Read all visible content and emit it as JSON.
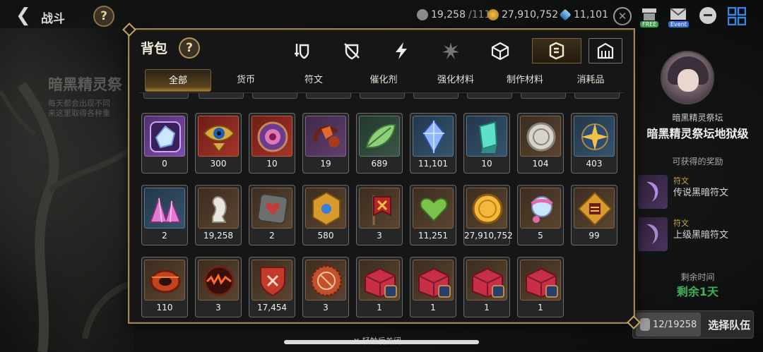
{
  "header": {
    "back_label": "战斗",
    "help_label": "?",
    "currencies": [
      {
        "name": "tokens",
        "value": "19,258",
        "suffix": "/111",
        "icon": "token-icon"
      },
      {
        "name": "gold",
        "value": "27,910,752",
        "icon": "gold-coin-icon"
      },
      {
        "name": "crystal",
        "value": "11,101",
        "icon": "crystal-icon"
      }
    ],
    "free_tag": "FREE",
    "event_tag": "Event"
  },
  "background": {
    "left_title": "暗黑精灵祭",
    "left_text_1": "每天都会出现不同",
    "left_text_2": "来这里取得各种重"
  },
  "right_panel": {
    "subtitle": "暗黑精灵祭坛",
    "title": "暗黑精灵祭坛地狱级",
    "rewards_label": "可获得的奖励",
    "rewards": [
      {
        "tag": "符文",
        "name": "传说黑暗符文"
      },
      {
        "tag": "符文",
        "name": "上级黑暗符文"
      }
    ],
    "remaining_label": "剩余时间",
    "remaining_value": "剩余1天",
    "team_count": "12/19258",
    "team_button": "选择队伍"
  },
  "bag": {
    "title": "背包",
    "help_label": "?",
    "category_icons": [
      "weapon-icon",
      "armor-icon",
      "lightning-icon",
      "spark-icon",
      "dice-icon",
      "material-icon",
      "shop-icon"
    ],
    "active_category": 5,
    "sub_tabs": [
      "全部",
      "货币",
      "符文",
      "催化剂",
      "强化材料",
      "制作材料",
      "消耗品"
    ],
    "active_sub_tab": 0,
    "close_hint": "轻触后关闭",
    "items": [
      {
        "icon": "purple-gem-icon",
        "count": "0",
        "rarity": "epic"
      },
      {
        "icon": "eye-emblem-icon",
        "count": "300",
        "rarity": "legend"
      },
      {
        "icon": "purple-orb-icon",
        "count": "10",
        "rarity": "legend"
      },
      {
        "icon": "red-amulet-icon",
        "count": "19",
        "rarity": "purple"
      },
      {
        "icon": "green-leaf-icon",
        "count": "689",
        "rarity": "green"
      },
      {
        "icon": "blue-crystal-icon",
        "count": "11,101",
        "rarity": "rare"
      },
      {
        "icon": "teal-crystal-icon",
        "count": "10",
        "rarity": "rare"
      },
      {
        "icon": "silver-coin-icon",
        "count": "104",
        "rarity": "brown"
      },
      {
        "icon": "star-compass-icon",
        "count": "403",
        "rarity": "rare"
      },
      {
        "icon": "pink-crystal-cluster-icon",
        "count": "2",
        "rarity": "rare"
      },
      {
        "icon": "silver-horse-icon",
        "count": "19,258",
        "rarity": "brown"
      },
      {
        "icon": "stone-heart-box-icon",
        "count": "2",
        "rarity": "brown"
      },
      {
        "icon": "gold-hex-emblem-icon",
        "count": "580",
        "rarity": "brown"
      },
      {
        "icon": "red-banner-icon",
        "count": "3",
        "rarity": "brown"
      },
      {
        "icon": "green-heart-icon",
        "count": "11,251",
        "rarity": "brown"
      },
      {
        "icon": "gold-coin-icon",
        "count": "27,910,752",
        "rarity": "brown"
      },
      {
        "icon": "pink-charm-icon",
        "count": "5",
        "rarity": "brown"
      },
      {
        "icon": "gold-badge-icon",
        "count": "99",
        "rarity": "brown"
      },
      {
        "icon": "red-ring-icon",
        "count": "110",
        "rarity": "brown"
      },
      {
        "icon": "fire-orb-icon",
        "count": "3",
        "rarity": "brown"
      },
      {
        "icon": "red-shield-icon",
        "count": "17,454",
        "rarity": "brown"
      },
      {
        "icon": "red-bottlecap-icon",
        "count": "3",
        "rarity": "brown"
      },
      {
        "icon": "red-chest-icon",
        "count": "1",
        "rarity": "brown"
      },
      {
        "icon": "red-chest-icon",
        "count": "1",
        "rarity": "brown"
      },
      {
        "icon": "red-chest-icon",
        "count": "1",
        "rarity": "brown"
      },
      {
        "icon": "red-chest-icon",
        "count": "1",
        "rarity": "brown"
      }
    ]
  },
  "colors": {
    "frame_gold": "#a0855a",
    "panel_bg": "#161616",
    "accent_gold": "#c9a24d",
    "remaining_green": "#3fae5a",
    "event_blue": "#3a6fd8",
    "free_green": "#3d9b45"
  }
}
